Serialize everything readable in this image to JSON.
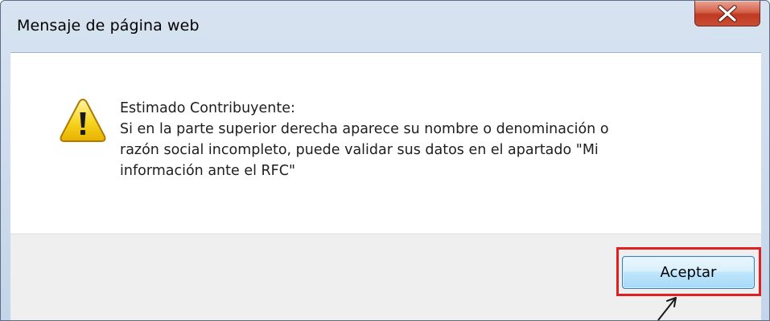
{
  "dialog": {
    "title": "Mensaje de página web",
    "close_icon": "close-x-icon",
    "warning_icon": "warning-triangle-icon",
    "message_lines": [
      "Estimado Contribuyente:",
      "Si en la parte superior derecha aparece su nombre o denominación o",
      "razón social incompleto, puede validar sus datos en el apartado \"Mi",
      "información ante el RFC\""
    ],
    "accept_label": "Aceptar"
  },
  "annotation": {
    "highlight_color": "#e02020"
  },
  "colors": {
    "close_button": "#c94d34",
    "accept_button_border": "#3c7fb1",
    "footer_bg": "#efefef"
  }
}
